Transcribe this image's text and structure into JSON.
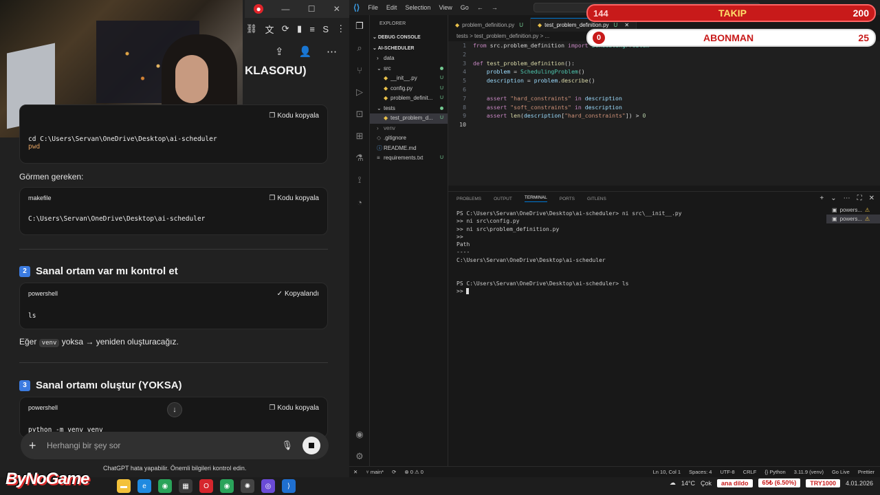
{
  "chat": {
    "heading_fragment": "KLASORU)",
    "code_blocks": [
      {
        "lang": "",
        "copy_label": "Kodu kopyala",
        "lines": [
          "cd C:\\Users\\Servan\\OneDrive\\Desktop\\ai-scheduler",
          "pwd"
        ]
      },
      {
        "lang": "makefile",
        "copy_label": "Kodu kopyala",
        "lines": [
          "C:\\Users\\Servan\\OneDrive\\Desktop\\ai-scheduler"
        ]
      },
      {
        "lang": "powershell",
        "copy_label": "Kopyalandı",
        "lines": [
          "ls"
        ]
      },
      {
        "lang": "powershell",
        "copy_label": "Kodu kopyala",
        "lines": [
          "python -m venv venv"
        ]
      }
    ],
    "para_gormen": "Görmen gereken:",
    "step2": {
      "num": "2",
      "title": "Sanal ortam var mı kontrol et"
    },
    "para_eger_pre": "Eğer",
    "para_eger_code": "venv",
    "para_eger_post": "yoksa → yeniden oluşturacağız.",
    "step3": {
      "num": "3",
      "title": "Sanal ortamı oluştur (YOKSA)"
    },
    "composer_placeholder": "Herhangi bir şey sor",
    "disclaimer": "ChatGPT hata yapabilir. Önemli bilgileri kontrol edin."
  },
  "vscode": {
    "menu": [
      "File",
      "Edit",
      "Selection",
      "View",
      "Go"
    ],
    "explorer_title": "EXPLORER",
    "debug_console": "DEBUG CONSOLE",
    "project": "AI-SCHEDULER",
    "tree": [
      {
        "name": "data",
        "indent": 1,
        "status": ""
      },
      {
        "name": "src",
        "indent": 1,
        "status": "dot"
      },
      {
        "name": "__init__.py",
        "indent": 2,
        "status": "U"
      },
      {
        "name": "config.py",
        "indent": 2,
        "status": "U"
      },
      {
        "name": "problem_definit...",
        "indent": 2,
        "status": "U"
      },
      {
        "name": "tests",
        "indent": 1,
        "status": "dot"
      },
      {
        "name": "test_problem_d...",
        "indent": 2,
        "status": "U",
        "selected": true
      },
      {
        "name": "venv",
        "indent": 1,
        "status": ""
      },
      {
        "name": ".gitignore",
        "indent": 1,
        "status": ""
      },
      {
        "name": "README.md",
        "indent": 1,
        "status": ""
      },
      {
        "name": "requirements.txt",
        "indent": 1,
        "status": "U"
      }
    ],
    "tabs": [
      {
        "label": "problem_definition.py",
        "status": "U"
      },
      {
        "label": "test_problem_definition.py",
        "status": "U"
      }
    ],
    "breadcrumb": "tests > test_problem_definition.py > ...",
    "panel_tabs": [
      "PROBLEMS",
      "OUTPUT",
      "TERMINAL",
      "PORTS",
      "GITLENS"
    ],
    "terminal_lines": [
      "PS C:\\Users\\Servan\\OneDrive\\Desktop\\ai-scheduler> ni src\\__init__.py",
      ">> ni src\\config.py",
      ">> ni src\\problem_definition.py",
      ">>",
      "Path",
      "----",
      "C:\\Users\\Servan\\OneDrive\\Desktop\\ai-scheduler",
      "",
      "",
      "PS C:\\Users\\Servan\\OneDrive\\Desktop\\ai-scheduler> ls",
      ">> "
    ],
    "terminal_list": [
      "powers...",
      "powers..."
    ],
    "status_left": [
      "main*",
      "0 ⚠ 0"
    ],
    "status_right": [
      "Ln 10, Col 1",
      "Spaces: 4",
      "UTF-8",
      "CRLF",
      "{} Python",
      "3.11.9 (venv)",
      "Go Live",
      "Prettier"
    ]
  },
  "overlay": {
    "takip_current": "144",
    "takip_label": "TAKIP",
    "takip_goal": "200",
    "abon_current": "0",
    "abon_label": "ABONMAN",
    "abon_goal": "25"
  },
  "taskbar": {
    "brand": "ByNoGame",
    "weather": "14°C",
    "weather_desc": "Çok",
    "ticker1": "ana dildo",
    "ticker2": "65₺ (6.50%)",
    "ticker3": "TRY1000",
    "date": "4.01.2026"
  }
}
